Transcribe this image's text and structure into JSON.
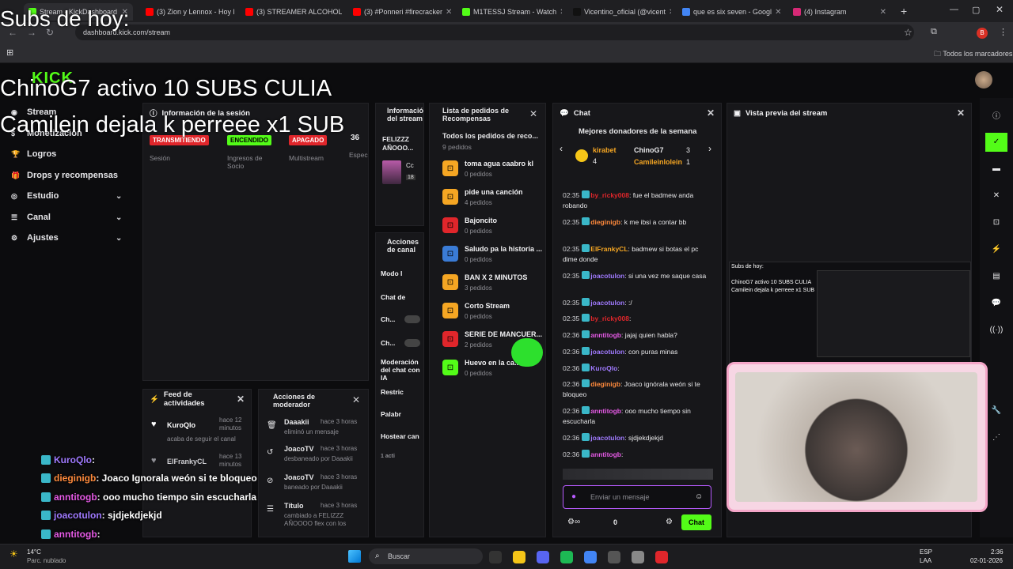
{
  "browser": {
    "tabs": [
      {
        "label": "Stream - KickDashboard",
        "active": true,
        "color": "#53fc18"
      },
      {
        "label": "(3) Zion y Lennox - Hoy le",
        "color": "#ff0000"
      },
      {
        "label": "(3) STREAMER ALCOHOLI",
        "color": "#ff0000"
      },
      {
        "label": "(3) #Ponneri #firecracker",
        "color": "#ff0000"
      },
      {
        "label": "M1TESSJ Stream - Watch",
        "color": "#53fc18"
      },
      {
        "label": "Vicentino_oficial (@vicent",
        "color": "#111111"
      },
      {
        "label": "que es six seven - Googl",
        "color": "#4285f4"
      },
      {
        "label": "(4) Instagram",
        "color": "#d62976"
      }
    ],
    "url": "dashboard.kick.com/stream",
    "bookmarks_label": "Todos los marcadores",
    "profile_letter": "B"
  },
  "overlay": {
    "subs_title": "Subs de hoy:",
    "sub_lines": [
      "ChinoG7 activo 10 SUBS CULIA",
      "Camilein dejala k perreee x1 SUB"
    ],
    "chat_lines": [
      {
        "user": "KuroQlo",
        "text": ":",
        "color": "#a07aff"
      },
      {
        "user": "dieginigb",
        "text": ": Joaco Ignorala weón si te bloqueo",
        "color": "#ff8a3c"
      },
      {
        "user": "anntitogb",
        "text": ": ooo mucho tiempo sin escucharla",
        "color": "#e65ae6"
      },
      {
        "user": "joacotulon",
        "text": ": sjdjekdjekjd",
        "color": "#a07aff"
      },
      {
        "user": "anntitogb",
        "text": ":",
        "color": "#e65ae6"
      }
    ]
  },
  "sidebar": {
    "logo": "KICK",
    "items": [
      {
        "label": "Stream",
        "icon": "stream-icon"
      },
      {
        "label": "Monetización",
        "icon": "money-icon"
      },
      {
        "label": "Logros",
        "icon": "trophy-icon"
      },
      {
        "label": "Drops y recompensas",
        "icon": "gift-icon"
      },
      {
        "label": "Estudio",
        "icon": "studio-icon"
      },
      {
        "label": "Canal",
        "icon": "channel-icon"
      },
      {
        "label": "Ajustes",
        "icon": "gear-icon"
      }
    ]
  },
  "session": {
    "title": "Información de la sesión",
    "badges": [
      {
        "label": "TRANSMITIENDO",
        "color": "#e0262b"
      },
      {
        "label": "ENCENDIDO",
        "color": "#53fc18"
      },
      {
        "label": "APAGADO",
        "color": "#e0262b"
      },
      {
        "label": "36"
      }
    ],
    "labels": [
      "Sesión",
      "Ingresos de Socio",
      "Multistream",
      "Espec"
    ]
  },
  "stream_info": {
    "title": "Información del stream",
    "name": "FELIZZZ AÑOOO...",
    "cat": "Cc",
    "num": "18"
  },
  "rewards": {
    "title": "Lista de pedidos de Recompensas",
    "all": "Todos los pedidos de reco...",
    "all_count": "9 pedidos",
    "items": [
      {
        "name": "toma agua caabro kl",
        "count": "0 pedidos",
        "color": "#f5a623"
      },
      {
        "name": "pide una canción",
        "count": "4 pedidos",
        "color": "#f5a623"
      },
      {
        "name": "Bajoncito",
        "count": "0 pedidos",
        "color": "#e0262b"
      },
      {
        "name": "Saludo pa la historia ...",
        "count": "0 pedidos",
        "color": "#3a7bd5"
      },
      {
        "name": "BAN X 2 MINUTOS",
        "count": "3 pedidos",
        "color": "#f5a623"
      },
      {
        "name": "Corto Stream",
        "count": "0 pedidos",
        "color": "#f5a623"
      },
      {
        "name": "SERIE DE MANCUER...",
        "count": "2 pedidos",
        "color": "#e0262b"
      },
      {
        "name": "Huevo en la ca...",
        "count": "0 pedidos",
        "color": "#53fc18"
      }
    ]
  },
  "actions": {
    "title": "Acciones de canal",
    "items": [
      "Modo l",
      "Chat de",
      "Ch...",
      "Ch...",
      "Moderación del chat con IA",
      "Restric",
      "Palabr",
      "Hostear can",
      "1 acti"
    ]
  },
  "feed": {
    "title": "Feed de actividades",
    "items": [
      {
        "user": "KuroQlo",
        "time": "hace 12 minutos",
        "desc": "acaba de seguir el canal"
      },
      {
        "user": "ElFrankyCL",
        "time": "hace 13 minutos",
        "desc": ""
      }
    ]
  },
  "modactions": {
    "title": "Acciones de moderador",
    "items": [
      {
        "user": "Daaakii",
        "time": "hace 3 horas",
        "desc": "eliminó un mensaje"
      },
      {
        "user": "JoacoTV",
        "time": "hace 3 horas",
        "desc": "desbaneado por Daaakii"
      },
      {
        "user": "JoacoTV",
        "time": "hace 3 horas",
        "desc": "baneado por Daaakii"
      },
      {
        "user": "Título",
        "time": "hace 3 horas",
        "desc": "cambiado a FELIZZZ AÑOOOO flex con los"
      }
    ]
  },
  "chat": {
    "title": "Chat",
    "donors_title": "Mejores donadores de la semana",
    "donors": [
      {
        "name": "kirabet",
        "val": "4"
      },
      {
        "name": "ChinoG7",
        "val": "3"
      },
      {
        "name": "Camileinlolein",
        "val": "1"
      }
    ],
    "messages": [
      {
        "t": "02:35",
        "u": "by_ricky008",
        "uc": "#e0262b",
        "m": ": fue el badmew anda robando"
      },
      {
        "t": "02:35",
        "u": "dieginigb",
        "uc": "#ff8a3c",
        "m": ": k me ibsi a contar bb"
      },
      {
        "t": "02:35",
        "u": "ElFrankyCL",
        "uc": "#f5a623",
        "m": ": badmew si botas el pc dime donde"
      },
      {
        "t": "02:35",
        "u": "joacotulon",
        "uc": "#a07aff",
        "m": ": si una vez me saque casa"
      },
      {
        "t": "02:35",
        "u": "joacotulon",
        "uc": "#a07aff",
        "m": ": :/"
      },
      {
        "t": "02:35",
        "u": "by_ricky008",
        "uc": "#e0262b",
        "m": ":"
      },
      {
        "t": "02:36",
        "u": "anntitogb",
        "uc": "#e65ae6",
        "m": ": jajaj quien habla?"
      },
      {
        "t": "02:36",
        "u": "joacotulon",
        "uc": "#a07aff",
        "m": ": con puras minas"
      },
      {
        "t": "02:36",
        "u": "KuroQlo",
        "uc": "#a07aff",
        "m": ":"
      },
      {
        "t": "02:36",
        "u": "dieginigb",
        "uc": "#ff8a3c",
        "m": ": Joaco ignórala weón si te bloqueo"
      },
      {
        "t": "02:36",
        "u": "anntitogb",
        "uc": "#e65ae6",
        "m": ": ooo mucho tiempo sin escucharla"
      },
      {
        "t": "02:36",
        "u": "joacotulon",
        "uc": "#a07aff",
        "m": ": sjdjekdjekjd"
      },
      {
        "t": "02:36",
        "u": "anntitogb",
        "uc": "#e65ae6",
        "m": ":"
      }
    ],
    "placeholder": "Enviar un mensaje",
    "count": "0",
    "send": "Chat"
  },
  "preview": {
    "title": "Vista previa del stream",
    "mini_title": "Subs de hoy:",
    "mini_l1": "ChinoG7 activo 10 SUBS CULIA",
    "mini_l2": "Camilein dejala k perreee x1 SUB"
  },
  "taskbar": {
    "temp": "14°C",
    "weather": "Parc. nublado",
    "search": "Buscar",
    "lang": "ESP",
    "lang2": "LAA",
    "time": "2:36",
    "date": "02-01-2026"
  }
}
